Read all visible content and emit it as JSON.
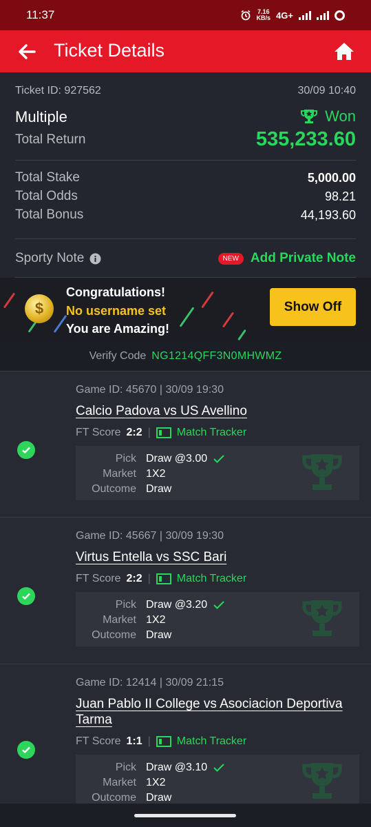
{
  "status_bar": {
    "time": "11:37",
    "speed_value": "7.16",
    "speed_unit": "KB/s",
    "network": "4G+"
  },
  "header": {
    "title": "Ticket Details"
  },
  "ticket": {
    "id_label": "Ticket ID: 927562",
    "datetime": "30/09 10:40",
    "type": "Multiple",
    "status": "Won",
    "total_return_label": "Total Return",
    "total_return": "535,233.60",
    "total_stake_label": "Total Stake",
    "total_stake": "5,000.00",
    "total_odds_label": "Total Odds",
    "total_odds": "98.21",
    "total_bonus_label": "Total Bonus",
    "total_bonus": "44,193.60",
    "note_label": "Sporty Note",
    "new_badge": "NEW",
    "add_note_label": "Add Private Note"
  },
  "banner": {
    "line1": "Congratulations!",
    "line2": "No username set",
    "line3": "You are Amazing!",
    "button_label": "Show Off",
    "colors": {
      "line2": "#f7c21b",
      "button": "#f7c21b"
    }
  },
  "verify": {
    "label": "Verify Code",
    "code": "NG1214QFF3N0MHWMZ"
  },
  "bets": [
    {
      "game_info": "Game ID: 45670 | 30/09 19:30",
      "match": "Calcio Padova vs US Avellino",
      "ft_label": "FT Score",
      "score": "2:2",
      "tracker_label": "Match Tracker",
      "pick_label": "Pick",
      "pick": "Draw @3.00",
      "market_label": "Market",
      "market": "1X2",
      "outcome_label": "Outcome",
      "outcome": "Draw"
    },
    {
      "game_info": "Game ID: 45667 | 30/09 19:30",
      "match": "Virtus Entella vs SSC Bari",
      "ft_label": "FT Score",
      "score": "2:2",
      "tracker_label": "Match Tracker",
      "pick_label": "Pick",
      "pick": "Draw @3.20",
      "market_label": "Market",
      "market": "1X2",
      "outcome_label": "Outcome",
      "outcome": "Draw"
    },
    {
      "game_info": "Game ID: 12414 | 30/09 21:15",
      "match": "Juan Pablo II College vs Asociacion Deportiva Tarma",
      "ft_label": "FT Score",
      "score": "1:1",
      "tracker_label": "Match Tracker",
      "pick_label": "Pick",
      "pick": "Draw @3.10",
      "market_label": "Market",
      "market": "1X2",
      "outcome_label": "Outcome",
      "outcome": "Draw"
    }
  ],
  "colors": {
    "header": "#e41827",
    "status_bar": "#7d0a10",
    "won_green": "#28d85c",
    "background": "#1b1e25"
  }
}
